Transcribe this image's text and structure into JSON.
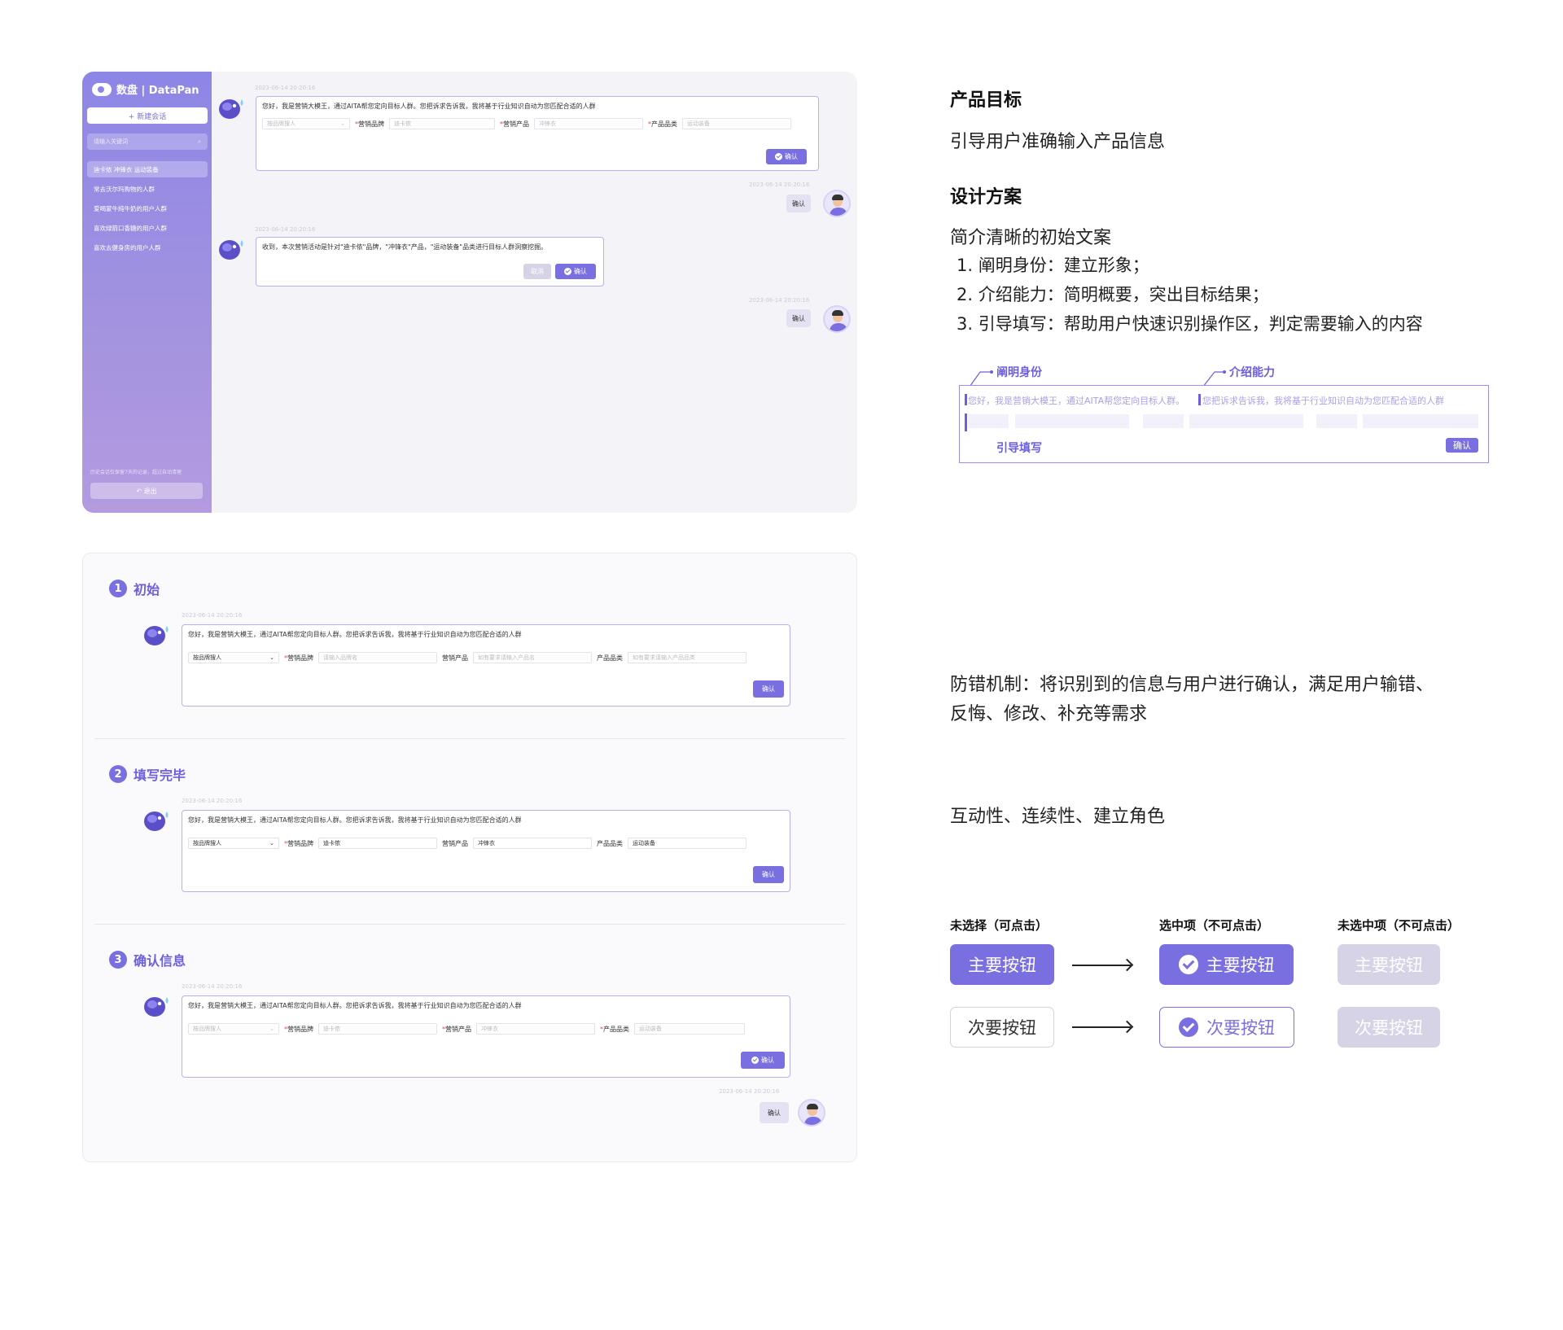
{
  "app": {
    "logo": "数盘 | DataPan",
    "new_chat": "+ 新建会话",
    "search_placeholder": "请输入关键词",
    "history": [
      "迪卡侬 冲锋衣 运动装备",
      "常去沃尔玛购物的人群",
      "爱喝蒙牛纯牛奶的用户人群",
      "喜欢绿箭口香糖的用户人群",
      "喜欢去健身房的用户人群"
    ],
    "footer_note": "历史会话仅保留7天的记录，超过自动清理",
    "logout": "退出",
    "timestamp": "2023-06-14 20:20:16",
    "greeting": "您好，我是营销大模王，通过AITA帮您定向目标人群。您把诉求告诉我，我将基于行业知识自动为您匹配合适的人群",
    "confirm_label": "确认",
    "cancel_label": "取消",
    "reply_msg": "收到，本次营销活动是针对\"迪卡侬\"品牌，\"冲锋衣\"产品，\"运动装备\"品类进行目标人群洞察挖掘。",
    "form": {
      "select_placeholder": "按品牌搜人",
      "brand_label": "营销品牌",
      "product_label": "营销产品",
      "category_label": "产品品类",
      "brand_value": "迪卡侬",
      "product_value": "冲锋衣",
      "category_value": "运动装备",
      "brand_placeholder": "请输入品牌名",
      "product_placeholder": "如有要求请输入产品名",
      "category_placeholder": "如有要求请输入产品品类"
    }
  },
  "right": {
    "goal_title": "产品目标",
    "goal_text": "引导用户准确输入产品信息",
    "design_title": "设计方案",
    "design_intro": "简介清晰的初始文案",
    "design_items": [
      "1. 阐明身份：建立形象；",
      "2. 介绍能力：简明概要，突出目标结果；",
      "3. 引导填写：帮助用户快速识别操作区，判定需要输入的内容"
    ],
    "ann_identity": "阐明身份",
    "ann_ability": "介绍能力",
    "ann_guide": "引导填写",
    "callout_part1": "您好，我是营销大模王，通过AITA帮您定向目标人群。",
    "callout_part2": "您把诉求告诉我，我将基于行业知识自动为您匹配合适的人群",
    "mistake_text_1": "防错机制：将识别到的信息与用户进行确认，满足用户输错、",
    "mistake_text_2": "反悔、修改、补充等需求",
    "interact_text": "互动性、连续性、建立角色"
  },
  "steps": [
    {
      "num": "1",
      "title": "初始"
    },
    {
      "num": "2",
      "title": "填写完毕"
    },
    {
      "num": "3",
      "title": "确认信息"
    }
  ],
  "buttons": {
    "col1": "未选择（可点击）",
    "col2": "选中项（不可点击）",
    "col3": "未选中项（不可点击）",
    "primary": "主要按钮",
    "secondary": "次要按钮"
  }
}
